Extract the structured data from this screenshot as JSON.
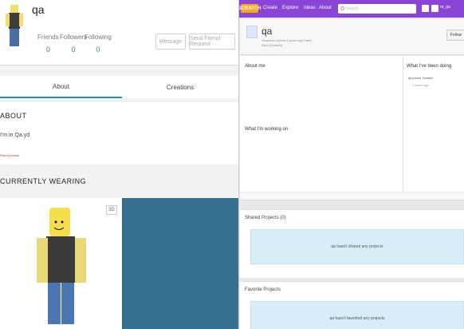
{
  "left": {
    "username": "qa",
    "stats": [
      {
        "label": "Friends",
        "value": "0"
      },
      {
        "label": "Followers",
        "value": "0"
      },
      {
        "label": "Following",
        "value": "0"
      }
    ],
    "message_button": "Message",
    "friend_request_button": "Send Friend Request",
    "tabs": [
      "About",
      "Creations"
    ],
    "about_title": "ABOUT",
    "about_text": "I'm in Qa.yd",
    "report": "Report Abuse",
    "wearing_title": "CURRENTLY WEARING",
    "toggle_label": "3D"
  },
  "right": {
    "logo": "SCRATCH",
    "nav_items": [
      "Create",
      "Explore",
      "Ideas",
      "About"
    ],
    "search_placeholder": "Search",
    "user_label": "ra_qa",
    "username": "qa",
    "sub1": "Scratcher Joined 4 years ago Earth",
    "sub2": "Here (Scratch)",
    "follow_button": "Follow",
    "about_me": "About me",
    "working_on": "What I'm working on",
    "been_doing": "What I've been doing",
    "activity_line1": "qa joined Scratch",
    "activity_line2": "4 years ago",
    "shared_projects_title": "Shared Projects (0)",
    "shared_projects_empty": "qa hasn't shared any projects",
    "favorite_projects_title": "Favorite Projects",
    "favorite_projects_empty": "qa hasn't favorited any projects",
    "colors": {
      "nav": "#8a45d6",
      "box": "#d9edf7"
    }
  }
}
